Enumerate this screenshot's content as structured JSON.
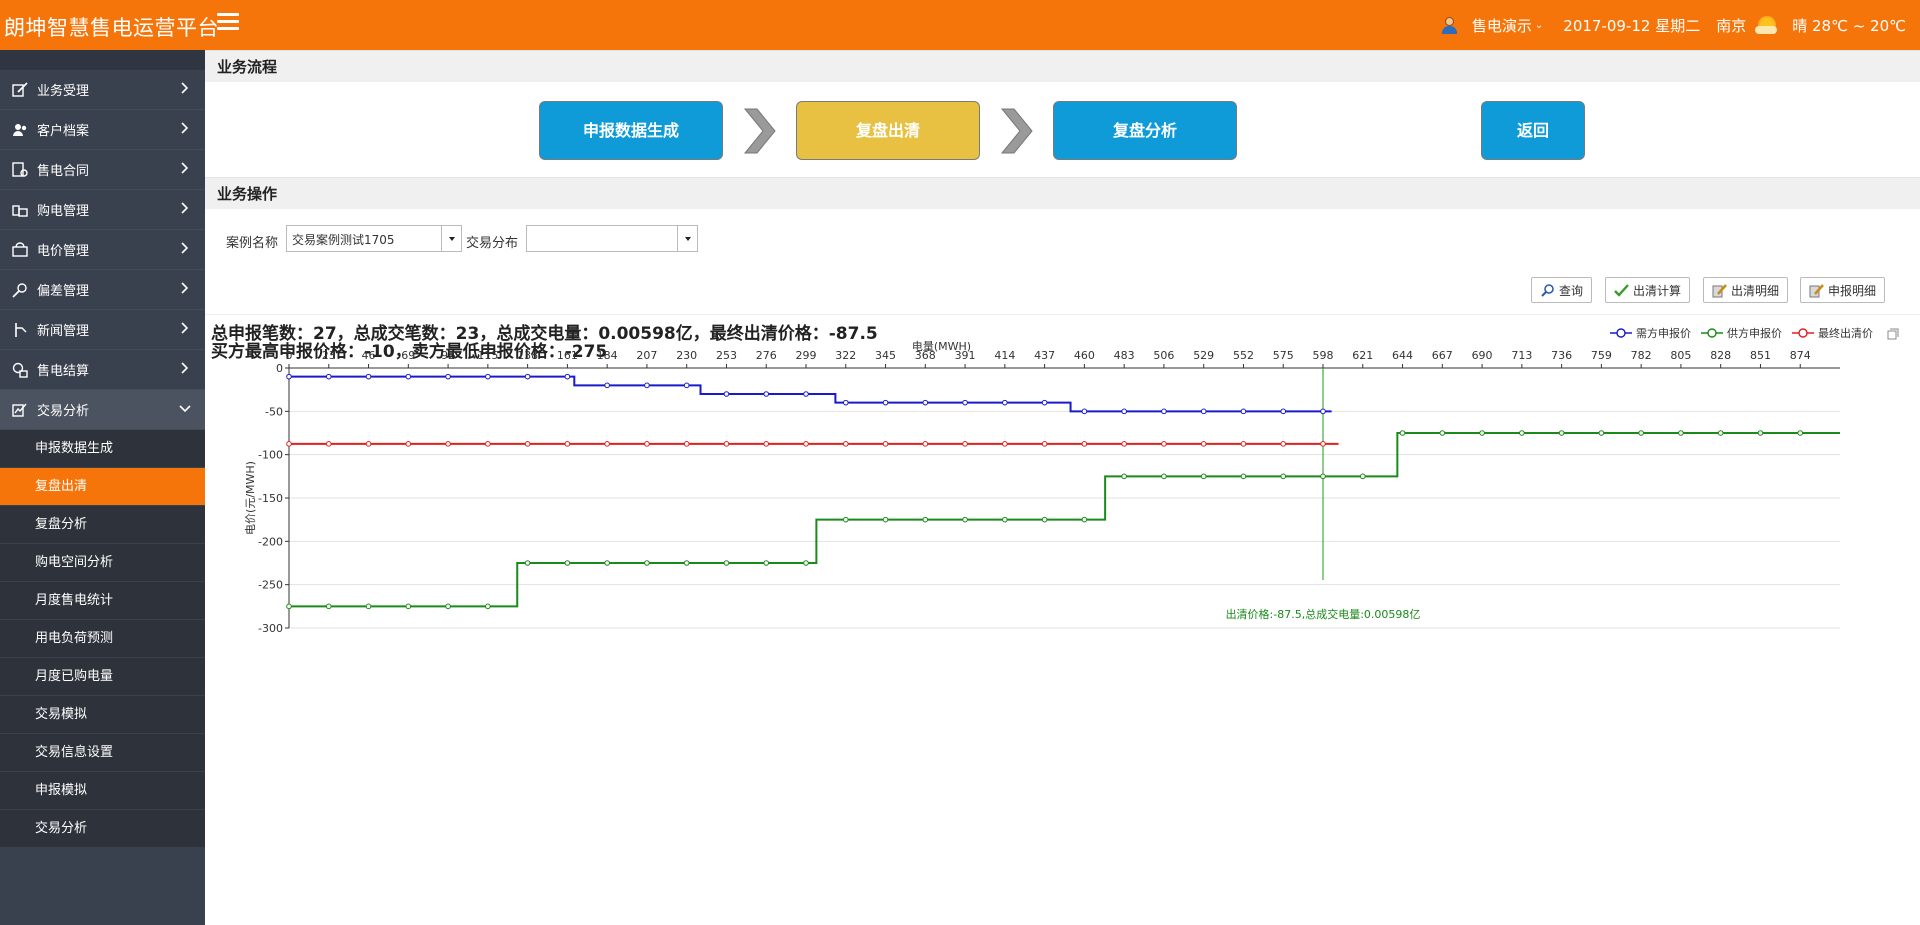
{
  "header": {
    "brand": "朗坤智慧售电运营平台",
    "user": "售电演示",
    "date": "2017-09-12 星期二",
    "city": "南京",
    "weather": "晴 28℃ ~ 20℃"
  },
  "sidebar": {
    "items": [
      {
        "label": "业务受理",
        "icon": "edit-icon"
      },
      {
        "label": "客户档案",
        "icon": "users-icon"
      },
      {
        "label": "售电合同",
        "icon": "contract-icon"
      },
      {
        "label": "购电管理",
        "icon": "purchase-icon"
      },
      {
        "label": "电价管理",
        "icon": "price-icon"
      },
      {
        "label": "偏差管理",
        "icon": "deviation-icon"
      },
      {
        "label": "新闻管理",
        "icon": "news-icon"
      },
      {
        "label": "售电结算",
        "icon": "settlement-icon"
      },
      {
        "label": "交易分析",
        "icon": "analysis-icon"
      }
    ],
    "submenu": [
      "申报数据生成",
      "复盘出清",
      "复盘分析",
      "购电空间分析",
      "月度售电统计",
      "用电负荷预测",
      "月度已购电量",
      "交易模拟",
      "交易信息设置",
      "申报模拟",
      "交易分析"
    ]
  },
  "main": {
    "flow_title": "业务流程",
    "flow_buttons": [
      "申报数据生成",
      "复盘出清",
      "复盘分析"
    ],
    "back_label": "返回",
    "ops_title": "业务操作",
    "case_label": "案例名称",
    "case_value": "交易案例测试1705",
    "dist_label": "交易分布",
    "dist_value": "",
    "toolbar": {
      "query": "查询",
      "clear_calc": "出清计算",
      "clear_detail": "出清明细",
      "report_detail": "申报明细"
    },
    "summary_line1": "总申报笔数：27，总成交笔数：23，总成交电量：0.00598亿，最终出清价格：-87.5",
    "summary_line2": "买方最高申报价格：-10，卖方最低申报价格：-275"
  },
  "chart_data": {
    "type": "line",
    "xlabel": "电量(MWH)",
    "ylabel": "电价(元/MWH)",
    "x_ticks": [
      0,
      23,
      46,
      69,
      92,
      115,
      138,
      161,
      184,
      207,
      230,
      253,
      276,
      299,
      322,
      345,
      368,
      391,
      414,
      437,
      460,
      483,
      506,
      529,
      552,
      575,
      598,
      621,
      644,
      667,
      690,
      713,
      736,
      759,
      782,
      805,
      828,
      851,
      874
    ],
    "y_ticks": [
      0,
      -50,
      -100,
      -150,
      -200,
      -250,
      -300
    ],
    "xlim": [
      0,
      897
    ],
    "ylim": [
      -300,
      0
    ],
    "series": [
      {
        "name": "需方申报价",
        "color": "#1a1acc",
        "steps": [
          [
            0,
            -10
          ],
          [
            165,
            -20
          ],
          [
            238,
            -30
          ],
          [
            316,
            -40
          ],
          [
            452,
            -50
          ],
          [
            603,
            -50
          ]
        ],
        "points": [
          0,
          23,
          46,
          69,
          92,
          115,
          138,
          161,
          184,
          207,
          230,
          253,
          276,
          299,
          322,
          345,
          368,
          391,
          414,
          437,
          460,
          483,
          506,
          529,
          552,
          575,
          598
        ]
      },
      {
        "name": "供方申报价",
        "color": "#1a8a1a",
        "steps": [
          [
            0,
            -275
          ],
          [
            132,
            -225
          ],
          [
            305,
            -175
          ],
          [
            472,
            -125
          ],
          [
            641,
            -75
          ],
          [
            897,
            -75
          ]
        ],
        "points": [
          0,
          23,
          46,
          69,
          92,
          115,
          138,
          161,
          184,
          207,
          230,
          253,
          276,
          299,
          322,
          345,
          368,
          391,
          414,
          437,
          460,
          483,
          506,
          529,
          552,
          575,
          598,
          621,
          644,
          667,
          690,
          713,
          736,
          759,
          782,
          805,
          828,
          851,
          874
        ]
      },
      {
        "name": "最终出清价",
        "color": "#e02020",
        "steps": [
          [
            0,
            -87.5
          ],
          [
            607,
            -87.5
          ]
        ],
        "points": [
          0,
          23,
          46,
          69,
          92,
          115,
          138,
          161,
          184,
          207,
          230,
          253,
          276,
          299,
          322,
          345,
          368,
          391,
          414,
          437,
          460,
          483,
          506,
          529,
          552,
          575,
          598
        ]
      }
    ],
    "clear_x": 598,
    "annotation": "出清价格:-87.5,总成交电量:0.00598亿"
  }
}
